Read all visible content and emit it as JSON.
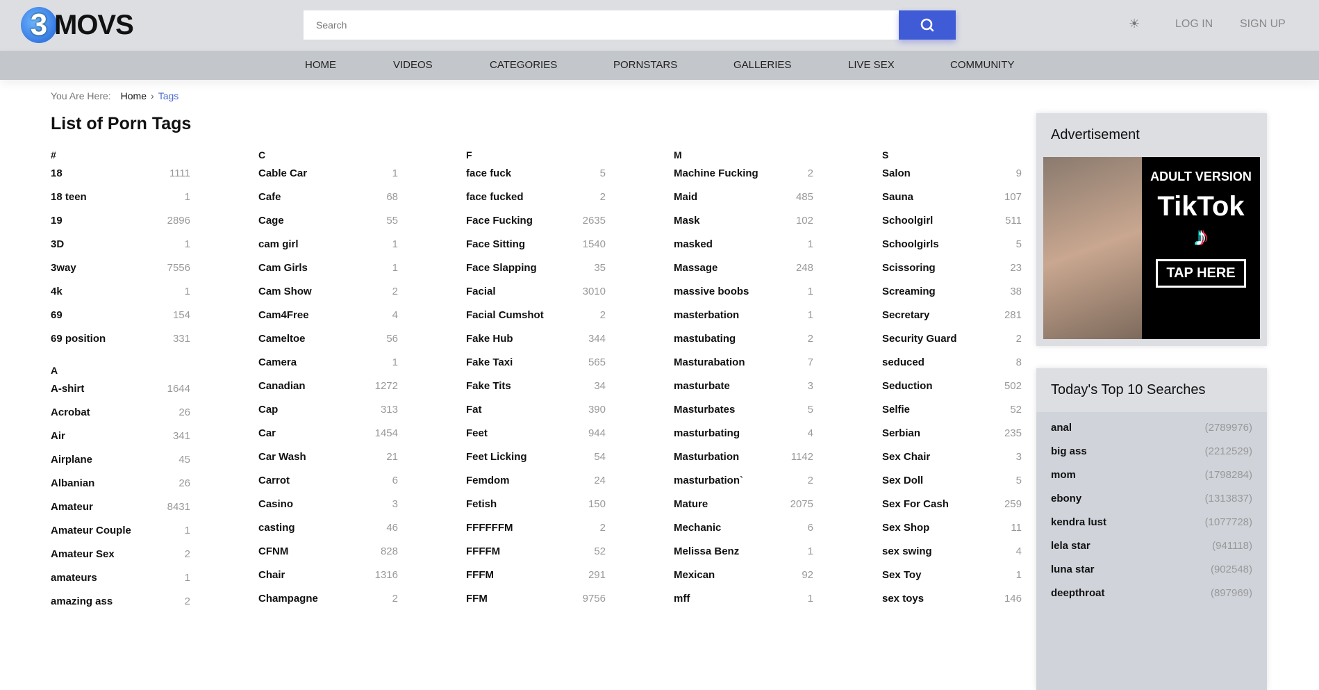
{
  "header": {
    "logo_text": "MOVS",
    "logo_mark": "3",
    "search_placeholder": "Search",
    "login": "LOG IN",
    "signup": "SIGN UP",
    "theme_icon": "sun-icon",
    "accent": "#3f5bd6"
  },
  "nav": [
    "HOME",
    "VIDEOS",
    "CATEGORIES",
    "PORNSTARS",
    "GALLERIES",
    "LIVE SEX",
    "COMMUNITY"
  ],
  "breadcrumb": {
    "label": "You Are Here:",
    "home": "Home",
    "current": "Tags"
  },
  "page_title": "List of Porn Tags",
  "columns": [
    [
      {
        "letter": "#",
        "tags": [
          [
            "18",
            "1111"
          ],
          [
            "18 teen",
            "1"
          ],
          [
            "19",
            "2896"
          ],
          [
            "3D",
            "1"
          ],
          [
            "3way",
            "7556"
          ],
          [
            "4k",
            "1"
          ],
          [
            "69",
            "154"
          ],
          [
            "69 position",
            "331"
          ]
        ]
      },
      {
        "letter": "A",
        "tags": [
          [
            "A-shirt",
            "1644"
          ],
          [
            "Acrobat",
            "26"
          ],
          [
            "Air",
            "341"
          ],
          [
            "Airplane",
            "45"
          ],
          [
            "Albanian",
            "26"
          ],
          [
            "Amateur",
            "8431"
          ],
          [
            "Amateur Couple",
            "1"
          ],
          [
            "Amateur Sex",
            "2"
          ],
          [
            "amateurs",
            "1"
          ],
          [
            "amazing ass",
            "2"
          ]
        ]
      }
    ],
    [
      {
        "letter": "C",
        "tags": [
          [
            "Cable Car",
            "1"
          ],
          [
            "Cafe",
            "68"
          ],
          [
            "Cage",
            "55"
          ],
          [
            "cam girl",
            "1"
          ],
          [
            "Cam Girls",
            "1"
          ],
          [
            "Cam Show",
            "2"
          ],
          [
            "Cam4Free",
            "4"
          ],
          [
            "Cameltoe",
            "56"
          ],
          [
            "Camera",
            "1"
          ],
          [
            "Canadian",
            "1272"
          ],
          [
            "Cap",
            "313"
          ],
          [
            "Car",
            "1454"
          ],
          [
            "Car Wash",
            "21"
          ],
          [
            "Carrot",
            "6"
          ],
          [
            "Casino",
            "3"
          ],
          [
            "casting",
            "46"
          ],
          [
            "CFNM",
            "828"
          ],
          [
            "Chair",
            "1316"
          ],
          [
            "Champagne",
            "2"
          ]
        ]
      }
    ],
    [
      {
        "letter": "F",
        "tags": [
          [
            "face fuck",
            "5"
          ],
          [
            "face fucked",
            "2"
          ],
          [
            "Face Fucking",
            "2635"
          ],
          [
            "Face Sitting",
            "1540"
          ],
          [
            "Face Slapping",
            "35"
          ],
          [
            "Facial",
            "3010"
          ],
          [
            "Facial Cumshot",
            "2"
          ],
          [
            "Fake Hub",
            "344"
          ],
          [
            "Fake Taxi",
            "565"
          ],
          [
            "Fake Tits",
            "34"
          ],
          [
            "Fat",
            "390"
          ],
          [
            "Feet",
            "944"
          ],
          [
            "Feet Licking",
            "54"
          ],
          [
            "Femdom",
            "24"
          ],
          [
            "Fetish",
            "150"
          ],
          [
            "FFFFFFM",
            "2"
          ],
          [
            "FFFFM",
            "52"
          ],
          [
            "FFFM",
            "291"
          ],
          [
            "FFM",
            "9756"
          ]
        ]
      }
    ],
    [
      {
        "letter": "M",
        "tags": [
          [
            "Machine Fucking",
            "2"
          ],
          [
            "Maid",
            "485"
          ],
          [
            "Mask",
            "102"
          ],
          [
            "masked",
            "1"
          ],
          [
            "Massage",
            "248"
          ],
          [
            "massive boobs",
            "1"
          ],
          [
            "masterbation",
            "1"
          ],
          [
            "mastubating",
            "2"
          ],
          [
            "Masturabation",
            "7"
          ],
          [
            "masturbate",
            "3"
          ],
          [
            "Masturbates",
            "5"
          ],
          [
            "masturbating",
            "4"
          ],
          [
            "Masturbation",
            "1142"
          ],
          [
            "masturbation`",
            "2"
          ],
          [
            "Mature",
            "2075"
          ],
          [
            "Mechanic",
            "6"
          ],
          [
            "Melissa Benz",
            "1"
          ],
          [
            "Mexican",
            "92"
          ],
          [
            "mff",
            "1"
          ]
        ]
      }
    ],
    [
      {
        "letter": "S",
        "tags": [
          [
            "Salon",
            "9"
          ],
          [
            "Sauna",
            "107"
          ],
          [
            "Schoolgirl",
            "511"
          ],
          [
            "Schoolgirls",
            "5"
          ],
          [
            "Scissoring",
            "23"
          ],
          [
            "Screaming",
            "38"
          ],
          [
            "Secretary",
            "281"
          ],
          [
            "Security Guard",
            "2"
          ],
          [
            "seduced",
            "8"
          ],
          [
            "Seduction",
            "502"
          ],
          [
            "Selfie",
            "52"
          ],
          [
            "Serbian",
            "235"
          ],
          [
            "Sex Chair",
            "3"
          ],
          [
            "Sex Doll",
            "5"
          ],
          [
            "Sex For Cash",
            "259"
          ],
          [
            "Sex Shop",
            "11"
          ],
          [
            "sex swing",
            "4"
          ],
          [
            "Sex Toy",
            "1"
          ],
          [
            "sex toys",
            "146"
          ]
        ]
      }
    ]
  ],
  "sidebar": {
    "ad_title": "Advertisement",
    "ad": {
      "line1": "ADULT VERSION",
      "line2": "TikTok",
      "cta": "TAP HERE"
    },
    "top_title": "Today's Top 10 Searches",
    "top": [
      [
        "anal",
        "(2789976)"
      ],
      [
        "big ass",
        "(2212529)"
      ],
      [
        "mom",
        "(1798284)"
      ],
      [
        "ebony",
        "(1313837)"
      ],
      [
        "kendra lust",
        "(1077728)"
      ],
      [
        "lela star",
        "(941118)"
      ],
      [
        "luna star",
        "(902548)"
      ],
      [
        "deepthroat",
        "(897969)"
      ]
    ]
  }
}
